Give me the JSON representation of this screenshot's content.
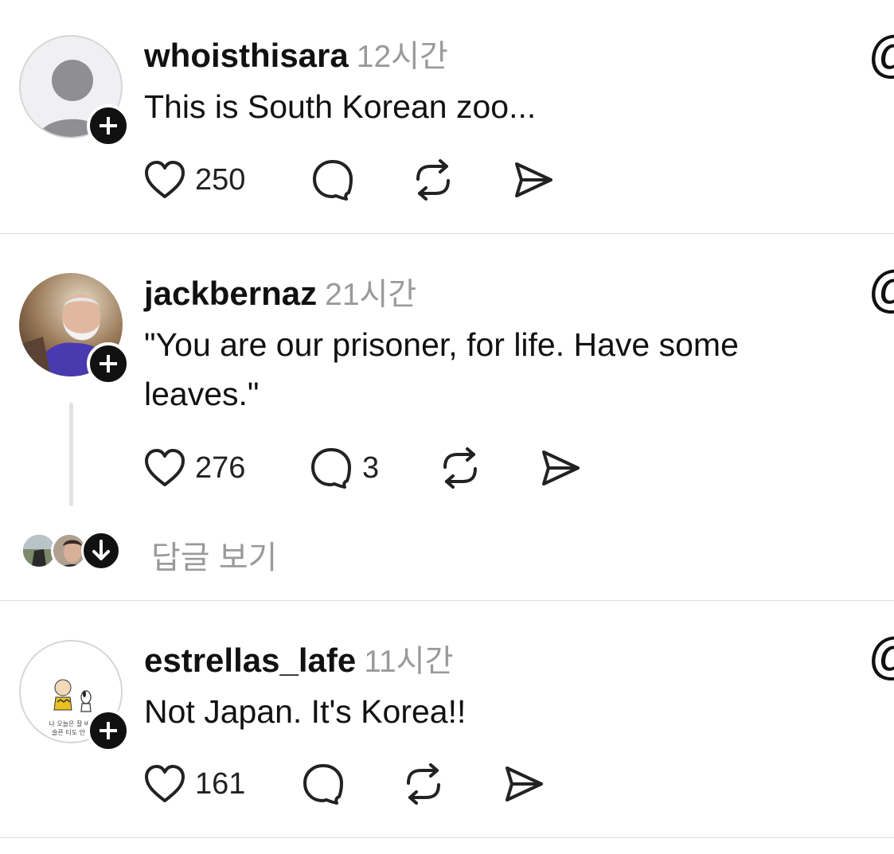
{
  "posts": [
    {
      "username": "whoisthisara",
      "time": "12시간",
      "text": "This is South Korean zoo...",
      "likes": "250",
      "comments": "",
      "more_glyph": "@"
    },
    {
      "username": "jackbernaz",
      "time": "21시간",
      "text": "\"You are our prisoner, for life. Have some leaves.\"",
      "likes": "276",
      "comments": "3",
      "more_glyph": "@",
      "replies_label": "답글 보기"
    },
    {
      "username": "estrellas_lafe",
      "time": "11시간",
      "text": "Not Japan. It's Korea!!",
      "likes": "161",
      "comments": "",
      "more_glyph": "@",
      "avatar_text": "나 오늘은 잘 버텼 / 슬픈 티도 안 났"
    }
  ],
  "icons": {
    "like": "heart-icon",
    "comment": "comment-icon",
    "repost": "repost-icon",
    "share": "share-icon",
    "follow": "plus-icon",
    "expand_replies": "arrow-down-icon"
  },
  "colors": {
    "text": "#111111",
    "muted": "#9a9a9a",
    "divider": "#dcdcdc",
    "thread_line": "#e2e2e2"
  }
}
